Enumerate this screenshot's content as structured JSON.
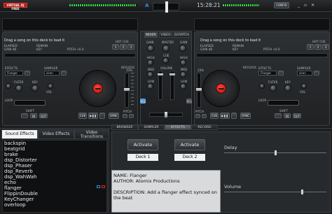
{
  "app": {
    "logo": "VIRTUAL DJ FREE",
    "clock": "15:28:21",
    "config_label": "CONFIG",
    "deck_a_letter": "A"
  },
  "colors": {
    "accent": "#3a8fd6",
    "record": "#e8271b",
    "platter_label": "#d8231a"
  },
  "deck1": {
    "title": "Drag a song on this deck to load it",
    "elapsed_label": "ELAPSED",
    "remain_label": "REMAIN",
    "gain": "GAIN dB",
    "key": "KEY",
    "pitch": "PITCH +0.0",
    "hot_cue": "HOT CUE",
    "hc": [
      "1",
      "2",
      "3"
    ],
    "effects_label": "EFFECTS",
    "sampler_label": "SAMPLER",
    "effect_value": "Flanger",
    "sampler_value": "siren",
    "filter": "FILTER",
    "key2": "KEY",
    "vol": "VOL",
    "loop_label": "LOOP",
    "keylock": "KEYLOCK",
    "keylock_pct": "33%",
    "shift": "SHIFT",
    "in_label": "IN",
    "out_label": "OUT",
    "cue": "CUE",
    "play": "▶❚❚",
    "sync": "SYNC",
    "pitch_label": "PITCH"
  },
  "deck2": {
    "title": "Drag a song on this deck to load it",
    "elapsed_label": "ELAPSED",
    "remain_label": "REMAIN",
    "gain": "GAIN dB",
    "key": "KEY",
    "pitch": "PITCH +0.0",
    "hot_cue": "HOT CUE",
    "hc": [
      "1",
      "2",
      "3"
    ],
    "effects_label": "EFFECTS",
    "sampler_label": "SAMPLER",
    "effect_value": "Flanger",
    "sampler_value": "siren",
    "filter": "FILTER",
    "key2": "KEY",
    "vol": "VOL",
    "loop_label": "LOOP",
    "keylock": "KEYLOCK",
    "keylock_pct": "33%",
    "shift": "SHIFT",
    "in_label": "IN",
    "out_label": "OUT",
    "cue": "CUE",
    "play": "▶❚❚",
    "sync": "SYNC",
    "pitch_label": "PITCH"
  },
  "mixer": {
    "tabs": [
      "MIXER",
      "VIDEO",
      "SCRATCH"
    ],
    "gain": "GAIN",
    "master": "MASTER",
    "cue": "CUE",
    "high": "HIGH",
    "med": "MED",
    "low": "LOW",
    "volume": "VOLUME",
    "pfl": "PFL"
  },
  "browser": {
    "left_tabs": [
      "Sound Effects",
      "Video Effects",
      "Video Transitions"
    ],
    "center_tabs": [
      "BROWSER",
      "SAMPLER",
      "EFFECTS",
      "RECORD"
    ],
    "effects": [
      "backspin",
      "beatgrid",
      "brake",
      "dsp_Distorter",
      "dsp_Phaser",
      "dsp_Reverb",
      "dsp_WahWah",
      "echo",
      "flanger",
      "FlippinDouble",
      "KeyChanger",
      "overloop"
    ],
    "activate1": "Activate",
    "activate2": "Activate",
    "deck1": "Deck 1",
    "deck2": "Deck 2",
    "name_line": "NAME: Flanger",
    "author_line": "AUTHOR: Atomix Productions",
    "desc_line": "DESCRIPTION: Add a flanger effect synced on the beat",
    "delay_label": "Delay",
    "volume_label": "Volume"
  }
}
